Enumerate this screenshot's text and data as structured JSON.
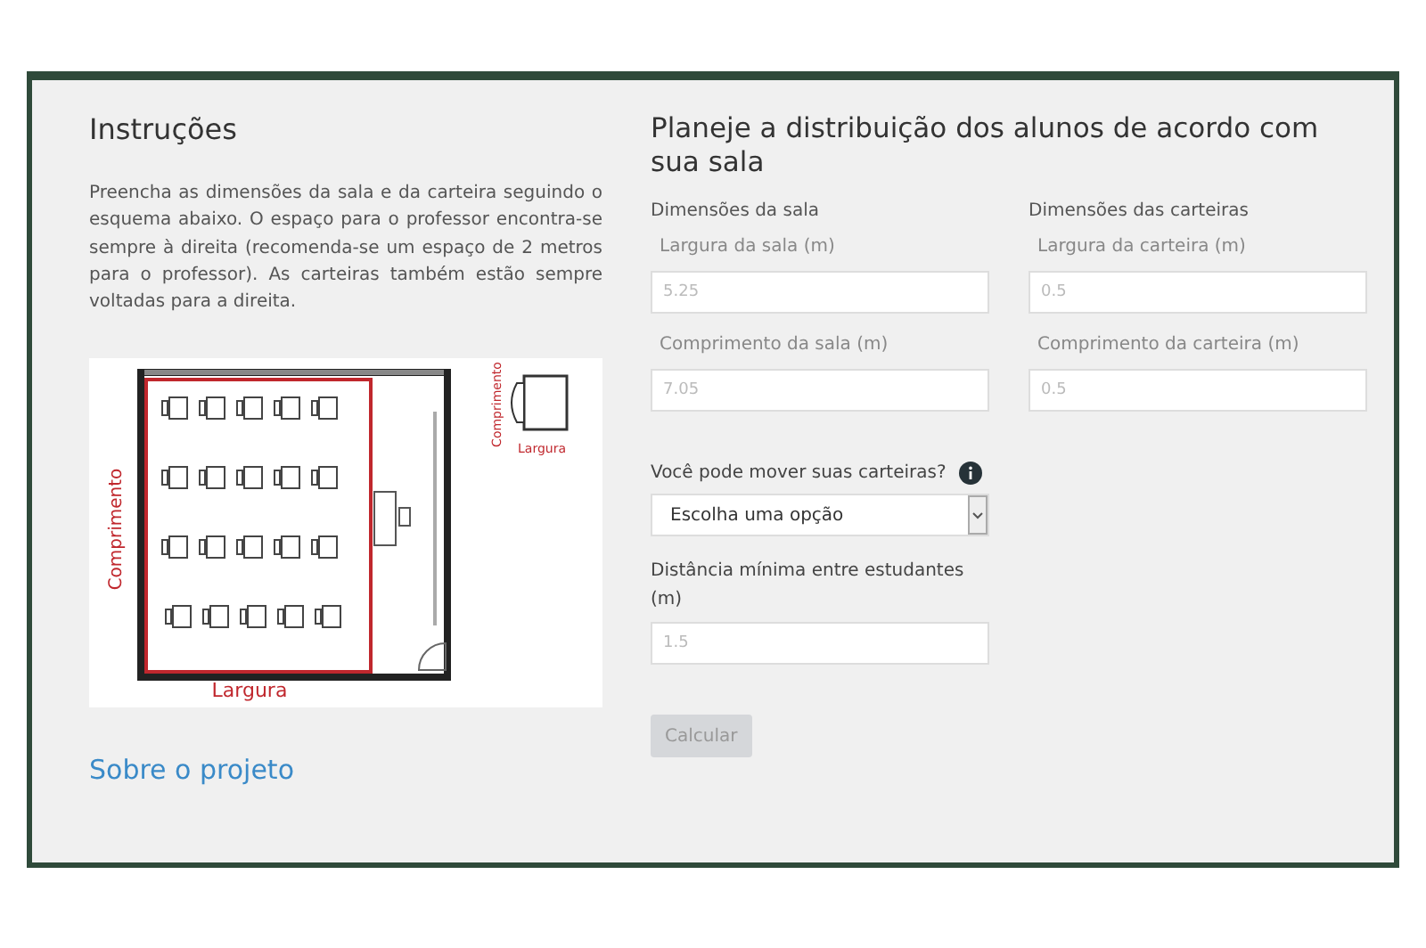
{
  "instructions": {
    "title": "Instruções",
    "text": "Preencha as dimensões da sala e da carteira seguindo o esquema abaixo. O espaço para o professor encontra-se sempre à direita (recomenda-se um espaço de 2 metros para o professor). As carteiras também estão sempre voltadas para a direita.",
    "diagram": {
      "room_length_label": "Comprimento",
      "room_width_label": "Largura",
      "desk_length_label": "Comprimento",
      "desk_width_label": "Largura"
    },
    "link": "Sobre o projeto"
  },
  "planner": {
    "title": "Planeje a distribuição dos alunos de acordo com sua sala",
    "groups": [
      {
        "heading": "Dimensões da sala",
        "fields": [
          {
            "label": "Largura da sala (m)",
            "placeholder": "5.25"
          },
          {
            "label": "Comprimento da sala (m)",
            "placeholder": "7.05"
          }
        ]
      },
      {
        "heading": "Dimensões das carteiras",
        "fields": [
          {
            "label": "Largura da carteira (m)",
            "placeholder": "0.5"
          },
          {
            "label": "Comprimento da carteira (m)",
            "placeholder": "0.5"
          }
        ]
      }
    ],
    "move_question": {
      "label": "Você pode mover suas carteiras?",
      "value": "Escolha uma opção"
    },
    "distance": {
      "label": "Distância mínima entre estudantes (m)",
      "placeholder": "1.5"
    },
    "submit": {
      "label": "Calcular",
      "disabled": true
    }
  }
}
